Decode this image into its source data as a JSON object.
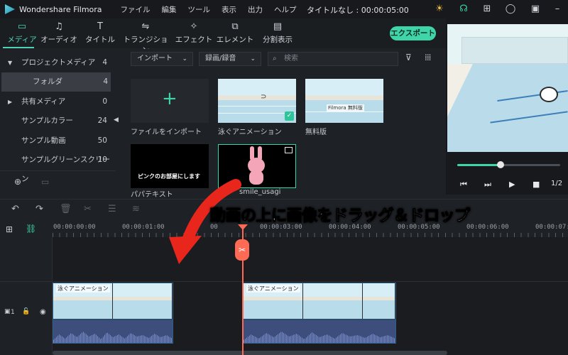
{
  "titlebar": {
    "app_name": "Wondershare Filmora",
    "menu": [
      "ファイル",
      "編集",
      "ツール",
      "表示",
      "出力",
      "ヘルプ"
    ],
    "document_title": "タイトルなし : 00:00:05:00"
  },
  "tabs": [
    {
      "label": "メディア",
      "icon": "folder-icon"
    },
    {
      "label": "オーディオ",
      "icon": "music-note-icon"
    },
    {
      "label": "タイトル",
      "icon": "text-icon"
    },
    {
      "label": "トランジション",
      "icon": "transition-icon"
    },
    {
      "label": "エフェクト",
      "icon": "effects-icon"
    },
    {
      "label": "エレメント",
      "icon": "element-icon"
    },
    {
      "label": "分割表示",
      "icon": "split-screen-icon"
    }
  ],
  "export_label": "エクスポート",
  "sidebar": {
    "items": [
      {
        "label": "プロジェクトメディア",
        "count": "4"
      },
      {
        "label": "フォルダ",
        "count": "4"
      },
      {
        "label": "共有メディア",
        "count": "0"
      },
      {
        "label": "サンプルカラー",
        "count": "24"
      },
      {
        "label": "サンプル動画",
        "count": "50"
      },
      {
        "label": "サンプルグリーンスクリーン",
        "count": "10"
      }
    ]
  },
  "media": {
    "import_dropdown": "インポート",
    "record_dropdown": "録画/録音",
    "search_placeholder": "検索",
    "items": [
      {
        "label": "ファイルをインポート",
        "icon": "plus-icon"
      },
      {
        "label": "泳ぐアニメーション"
      },
      {
        "label": "無料版",
        "watermark": "Filmora 無料版"
      },
      {
        "label": "パパテキスト",
        "caption": "ピンクのお部屋にします"
      },
      {
        "label": "smile_usagi"
      }
    ]
  },
  "preview": {
    "zoom": "1/2",
    "progress": 0.42
  },
  "timeline": {
    "ticks": [
      "00:00:00:00",
      "00:00:01:00",
      "00:00:02:00",
      "00:00:03:00",
      "00:00:04:00",
      "00:00:05:00",
      "00:00:06:00",
      "00:00:07:00"
    ],
    "ruler_first": "00:00:00:00",
    "ruler_second": "00:00:01:00",
    "ruler_third": "00:00:03:00",
    "ruler_fourth": "00:00:04:00",
    "ruler_fifth": "00:00:05:00",
    "ruler_sixth": "00:00:06:00",
    "ruler_seventh": "00:00:07:00",
    "ruler_partial": "00",
    "track_label": "1",
    "clips": [
      {
        "title": "泳ぐアニメーション"
      },
      {
        "title": "泳ぐアニメーション"
      }
    ]
  },
  "overlay": {
    "instruction": "動画の上に画像をドラッグ＆ドロップ"
  }
}
